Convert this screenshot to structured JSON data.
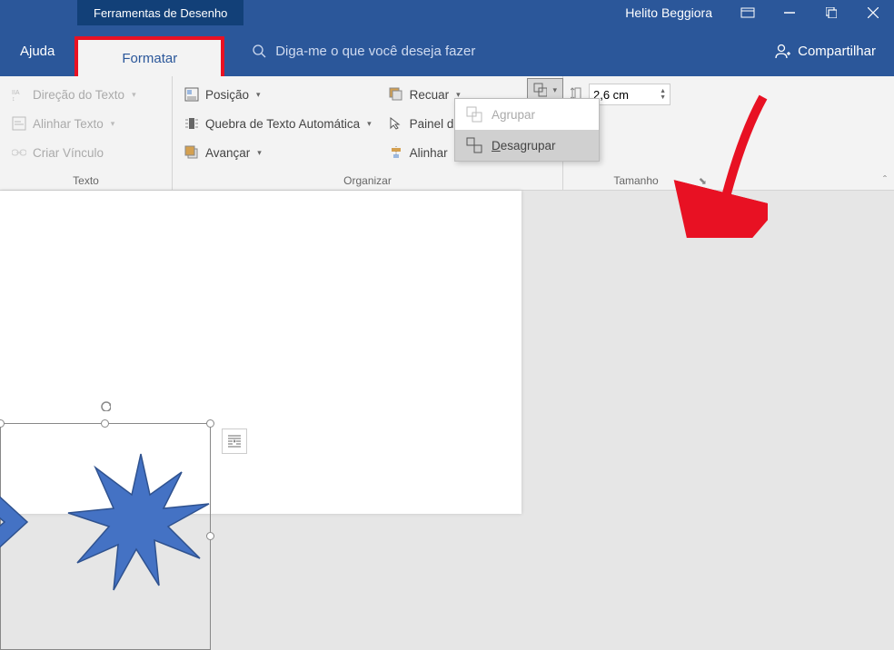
{
  "titlebar": {
    "tool_tab": "Ferramentas de Desenho",
    "user": "Helito Beggiora"
  },
  "tabs": {
    "ajuda": "Ajuda",
    "formatar": "Formatar",
    "tellme": "Diga-me o que você deseja fazer",
    "share": "Compartilhar"
  },
  "ribbon": {
    "texto": {
      "direcao": "Direção do Texto",
      "alinhar": "Alinhar Texto",
      "vinculo": "Criar Vínculo",
      "label": "Texto"
    },
    "organizar": {
      "posicao": "Posição",
      "quebra": "Quebra de Texto Automática",
      "avancar": "Avançar",
      "recuar": "Recuar",
      "painel": "Painel de Seleção",
      "alinhar": "Alinhar",
      "label": "Organizar"
    },
    "tamanho": {
      "value": "2,6 cm",
      "label": "Tamanho"
    }
  },
  "menu": {
    "agrupar": "Agrupar",
    "desagrupar": "Desagrupar"
  },
  "icons": {
    "search": "search-icon",
    "share": "share-user-icon"
  }
}
